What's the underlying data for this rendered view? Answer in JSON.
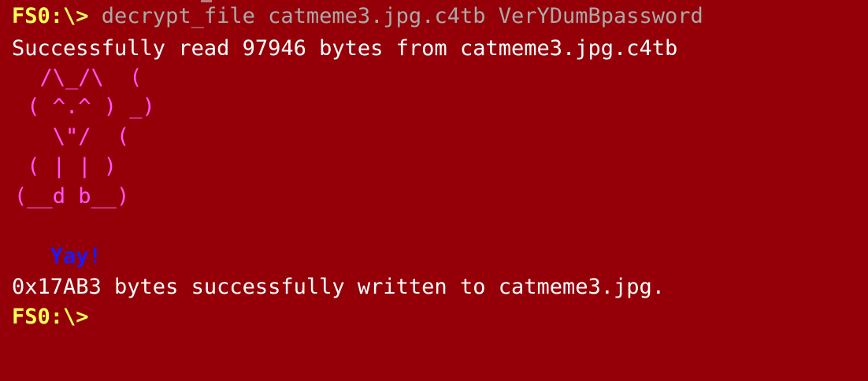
{
  "terminal": {
    "prompt": "FS0:\\>",
    "command": " decrypt_file catmeme3.jpg.c4tb VerYDumBpassword",
    "read_message": "Successfully read 97946 bytes from catmeme3.jpg.c4tb",
    "ascii_art": [
      "  /\\_/\\  (",
      " ( ^.^ ) _)",
      "   \\\"/  (",
      " ( | | )",
      "(__d b__)"
    ],
    "yay": "   Yay!",
    "write_message": "0x17AB3 bytes successfully written to catmeme3.jpg.",
    "final_prompt": "FS0:\\>"
  },
  "colors": {
    "background": "#950008",
    "prompt": "#ffff55",
    "command": "#aaaaaa",
    "output": "#ffffff",
    "art": "#ff55ff",
    "yay": "#1a1aff"
  }
}
